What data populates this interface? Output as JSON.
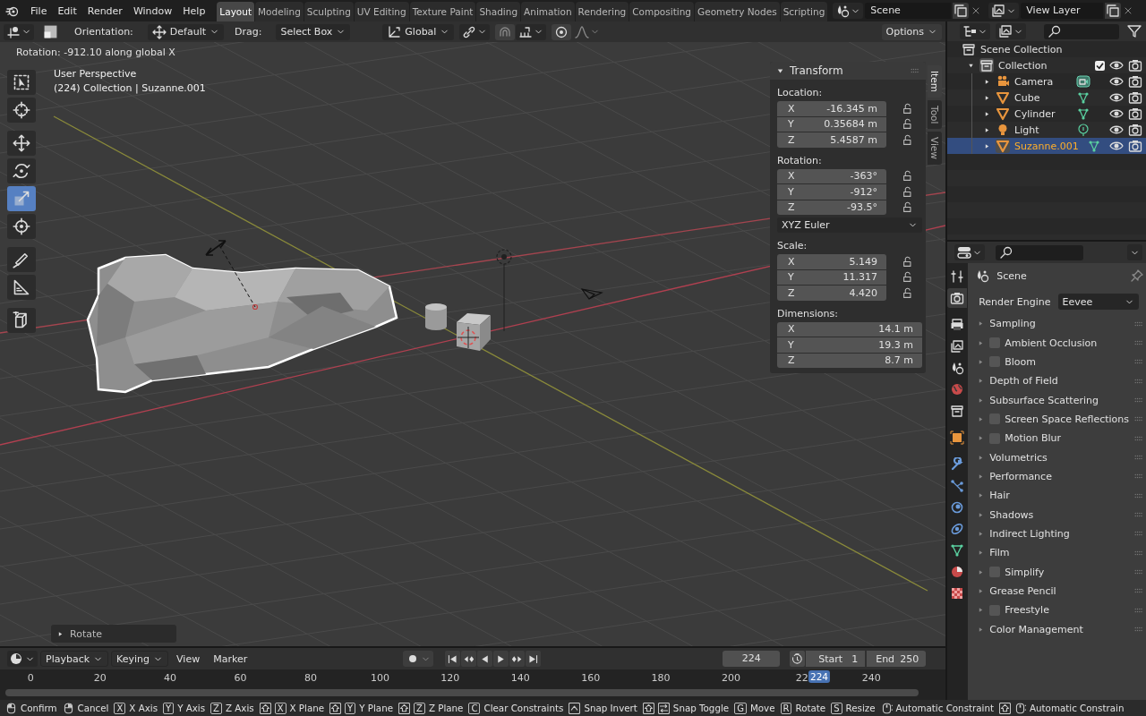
{
  "topbar": {
    "menus": [
      "File",
      "Edit",
      "Render",
      "Window",
      "Help"
    ],
    "workspaces": [
      {
        "label": "Layout",
        "selected": true
      },
      {
        "label": "Modeling",
        "selected": false
      },
      {
        "label": "Sculpting",
        "selected": false
      },
      {
        "label": "UV Editing",
        "selected": false
      },
      {
        "label": "Texture Paint",
        "selected": false
      },
      {
        "label": "Shading",
        "selected": false
      },
      {
        "label": "Animation",
        "selected": false
      },
      {
        "label": "Rendering",
        "selected": false
      },
      {
        "label": "Compositing",
        "selected": false
      },
      {
        "label": "Geometry Nodes",
        "selected": false
      },
      {
        "label": "Scripting",
        "selected": false
      }
    ],
    "scene": "Scene",
    "view_layer": "View Layer"
  },
  "tool_header": {
    "orientation_label": "Orientation:",
    "orientation": "Default",
    "drag_label": "Drag:",
    "drag": "Select Box",
    "transform_orientation": "Global",
    "options": "Options"
  },
  "viewport": {
    "operator_status": "Rotation: -912.10 along global X",
    "view_name": "User Perspective",
    "object_info": "(224) Collection | Suzanne.001",
    "last_operator": "Rotate",
    "tools": [
      {
        "selected": false
      },
      {
        "selected": false
      },
      {
        "selected": false
      },
      {
        "selected": false
      },
      {
        "selected": true
      },
      {
        "selected": false
      },
      {
        "selected": false
      },
      {
        "selected": false
      },
      {
        "selected": false
      }
    ]
  },
  "transform_panel": {
    "title": "Transform",
    "sections": [
      {
        "label": "Location:",
        "locks": true,
        "fields": [
          {
            "axis": "X",
            "value": "-16.345 m"
          },
          {
            "axis": "Y",
            "value": "0.35684 m"
          },
          {
            "axis": "Z",
            "value": "5.4587 m"
          }
        ]
      },
      {
        "label": "Rotation:",
        "locks": true,
        "fields": [
          {
            "axis": "X",
            "value": "-363°"
          },
          {
            "axis": "Y",
            "value": "-912°"
          },
          {
            "axis": "Z",
            "value": "-93.5°"
          }
        ],
        "mode": "XYZ Euler"
      },
      {
        "label": "Scale:",
        "locks": true,
        "fields": [
          {
            "axis": "X",
            "value": "5.149"
          },
          {
            "axis": "Y",
            "value": "11.317"
          },
          {
            "axis": "Z",
            "value": "4.420"
          }
        ]
      },
      {
        "label": "Dimensions:",
        "locks": false,
        "fields": [
          {
            "axis": "X",
            "value": "14.1 m"
          },
          {
            "axis": "Y",
            "value": "19.3 m"
          },
          {
            "axis": "Z",
            "value": "8.7 m"
          }
        ]
      }
    ]
  },
  "sidebar_tabs": [
    {
      "label": "Item",
      "selected": true
    },
    {
      "label": "Tool",
      "selected": false
    },
    {
      "label": "View",
      "selected": false
    }
  ],
  "outliner": {
    "root": "Scene Collection",
    "collections": [
      {
        "name": "Collection",
        "expanded": true,
        "checked": true,
        "children": [
          {
            "name": "Camera",
            "kind": "camera",
            "selected": false
          },
          {
            "name": "Cube",
            "kind": "mesh",
            "selected": false
          },
          {
            "name": "Cylinder",
            "kind": "mesh",
            "selected": false
          },
          {
            "name": "Light",
            "kind": "light",
            "selected": false
          },
          {
            "name": "Suzanne.001",
            "kind": "mesh",
            "selected": true
          }
        ]
      }
    ]
  },
  "properties": {
    "tabs": [
      {
        "selected": false
      },
      {
        "selected": true
      },
      {
        "selected": false
      },
      {
        "selected": false
      },
      {
        "selected": false
      },
      {
        "selected": false
      },
      {
        "selected": false
      },
      {
        "selected": false
      },
      {
        "selected": false
      },
      {
        "selected": false
      },
      {
        "selected": false
      },
      {
        "selected": false
      },
      {
        "selected": false
      },
      {
        "selected": false
      },
      {
        "selected": false
      }
    ],
    "context": "Scene",
    "render_engine_label": "Render Engine",
    "render_engine": "Eevee",
    "panels": [
      {
        "label": "Sampling",
        "kind": "plain"
      },
      {
        "label": "Ambient Occlusion",
        "kind": "toggle",
        "checked": false
      },
      {
        "label": "Bloom",
        "kind": "toggle",
        "checked": false
      },
      {
        "label": "Depth of Field",
        "kind": "plain"
      },
      {
        "label": "Subsurface Scattering",
        "kind": "plain"
      },
      {
        "label": "Screen Space Reflections",
        "kind": "toggle",
        "checked": false
      },
      {
        "label": "Motion Blur",
        "kind": "toggle",
        "checked": false
      },
      {
        "label": "Volumetrics",
        "kind": "plain"
      },
      {
        "label": "Performance",
        "kind": "plain"
      },
      {
        "label": "Hair",
        "kind": "plain"
      },
      {
        "label": "Shadows",
        "kind": "plain"
      },
      {
        "label": "Indirect Lighting",
        "kind": "plain"
      },
      {
        "label": "Film",
        "kind": "plain"
      },
      {
        "label": "Simplify",
        "kind": "toggle",
        "checked": false
      },
      {
        "label": "Grease Pencil",
        "kind": "plain"
      },
      {
        "label": "Freestyle",
        "kind": "toggle",
        "checked": false
      },
      {
        "label": "Color Management",
        "kind": "plain"
      }
    ]
  },
  "timeline": {
    "menus": [
      "Playback",
      "Keying",
      "View",
      "Marker"
    ],
    "auto_keying": false,
    "current_frame": "224",
    "start_label": "Start",
    "start": "1",
    "end_label": "End",
    "end": "250",
    "ruler": [
      "0",
      "20",
      "40",
      "60",
      "80",
      "100",
      "120",
      "140",
      "160",
      "180",
      "200",
      "22",
      "240"
    ],
    "playhead": "224"
  },
  "status_bar": [
    {
      "kind": "mouse-left",
      "label": "Confirm"
    },
    {
      "kind": "mouse-right",
      "label": "Cancel"
    },
    {
      "kind": "key",
      "key": "X",
      "label": "X Axis"
    },
    {
      "kind": "key",
      "key": "Y",
      "label": "Y Axis"
    },
    {
      "kind": "key",
      "key": "Z",
      "label": "Z Axis"
    },
    {
      "kind": "shift-key",
      "key": "X",
      "label": "X Plane"
    },
    {
      "kind": "shift-key",
      "key": "Y",
      "label": "Y Plane"
    },
    {
      "kind": "shift-key",
      "key": "Z",
      "label": "Z Plane"
    },
    {
      "kind": "key",
      "key": "C",
      "label": "Clear Constraints"
    },
    {
      "kind": "ctrl",
      "label": "Snap Invert"
    },
    {
      "kind": "shift-tab",
      "label": "Snap Toggle"
    },
    {
      "kind": "key",
      "key": "G",
      "label": "Move"
    },
    {
      "kind": "key",
      "key": "R",
      "label": "Rotate"
    },
    {
      "kind": "key",
      "key": "S",
      "label": "Resize"
    },
    {
      "kind": "mouse-middle",
      "label": "Automatic Constraint"
    },
    {
      "kind": "shift-mouse-middle",
      "label": "Automatic Constrain"
    }
  ]
}
